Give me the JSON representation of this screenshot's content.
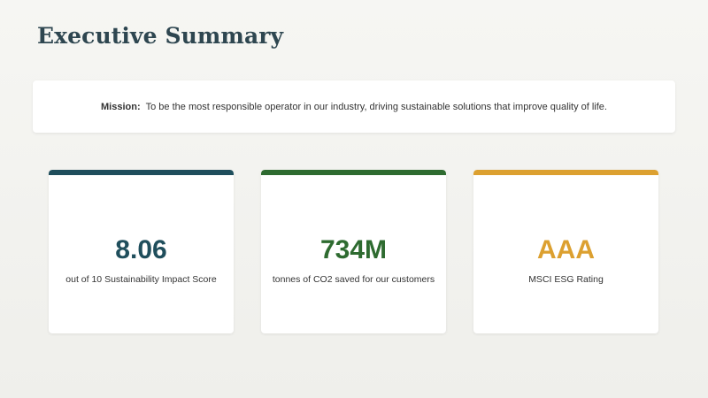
{
  "header": {
    "title": "Executive Summary"
  },
  "mission": {
    "label": "Mission:",
    "text": "To be the most responsible operator in our industry, driving sustainable solutions that improve quality of life."
  },
  "metrics": [
    {
      "value": "8.06",
      "caption": "out of 10 Sustainability Impact Score",
      "color": "#1f4e5c"
    },
    {
      "value": "734M",
      "caption": "tonnes of CO2 saved for our customers",
      "color": "#2e6b30"
    },
    {
      "value": "AAA",
      "caption": "MSCI ESG Rating",
      "color": "#dca030"
    }
  ]
}
